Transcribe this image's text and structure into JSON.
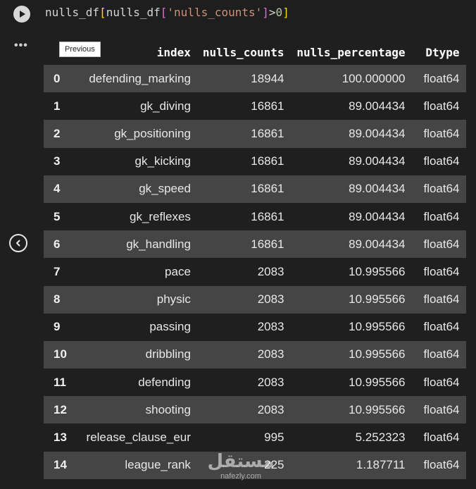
{
  "code": {
    "var1": "nulls_df",
    "open1": "[",
    "var2": "nulls_df",
    "open2": "[",
    "key": "'nulls_counts'",
    "close2": "]",
    "op": ">",
    "value": "0",
    "close1": "]"
  },
  "toolbar": {
    "run_icon": "play-icon",
    "more_label": "•••",
    "prev_icon": "chevron-left-icon",
    "tooltip": "Previous"
  },
  "table": {
    "headers": [
      "",
      "index",
      "nulls_counts",
      "nulls_percentage",
      "Dtype"
    ],
    "rows": [
      {
        "idx": "0",
        "index": "defending_marking",
        "nulls_counts": "18944",
        "nulls_percentage": "100.000000",
        "dtype": "float64"
      },
      {
        "idx": "1",
        "index": "gk_diving",
        "nulls_counts": "16861",
        "nulls_percentage": "89.004434",
        "dtype": "float64"
      },
      {
        "idx": "2",
        "index": "gk_positioning",
        "nulls_counts": "16861",
        "nulls_percentage": "89.004434",
        "dtype": "float64"
      },
      {
        "idx": "3",
        "index": "gk_kicking",
        "nulls_counts": "16861",
        "nulls_percentage": "89.004434",
        "dtype": "float64"
      },
      {
        "idx": "4",
        "index": "gk_speed",
        "nulls_counts": "16861",
        "nulls_percentage": "89.004434",
        "dtype": "float64"
      },
      {
        "idx": "5",
        "index": "gk_reflexes",
        "nulls_counts": "16861",
        "nulls_percentage": "89.004434",
        "dtype": "float64"
      },
      {
        "idx": "6",
        "index": "gk_handling",
        "nulls_counts": "16861",
        "nulls_percentage": "89.004434",
        "dtype": "float64"
      },
      {
        "idx": "7",
        "index": "pace",
        "nulls_counts": "2083",
        "nulls_percentage": "10.995566",
        "dtype": "float64"
      },
      {
        "idx": "8",
        "index": "physic",
        "nulls_counts": "2083",
        "nulls_percentage": "10.995566",
        "dtype": "float64"
      },
      {
        "idx": "9",
        "index": "passing",
        "nulls_counts": "2083",
        "nulls_percentage": "10.995566",
        "dtype": "float64"
      },
      {
        "idx": "10",
        "index": "dribbling",
        "nulls_counts": "2083",
        "nulls_percentage": "10.995566",
        "dtype": "float64"
      },
      {
        "idx": "11",
        "index": "defending",
        "nulls_counts": "2083",
        "nulls_percentage": "10.995566",
        "dtype": "float64"
      },
      {
        "idx": "12",
        "index": "shooting",
        "nulls_counts": "2083",
        "nulls_percentage": "10.995566",
        "dtype": "float64"
      },
      {
        "idx": "13",
        "index": "release_clause_eur",
        "nulls_counts": "995",
        "nulls_percentage": "5.252323",
        "dtype": "float64"
      },
      {
        "idx": "14",
        "index": "league_rank",
        "nulls_counts": "225",
        "nulls_percentage": "1.187711",
        "dtype": "float64"
      }
    ]
  },
  "watermark": {
    "arabic": "مستقل",
    "url": "nafezly.com"
  }
}
